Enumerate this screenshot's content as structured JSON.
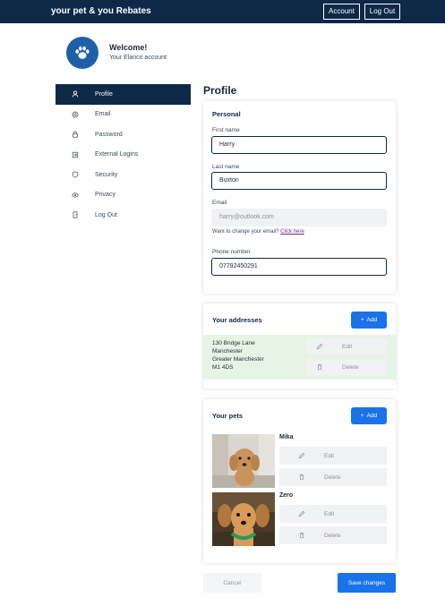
{
  "header": {
    "brand": "your pet & you Rebates",
    "account_label": "Account",
    "logout_label": "Log Out",
    "background_color": "#0e2847"
  },
  "welcome": {
    "title": "Welcome!",
    "subtitle": "Your Elanco account",
    "avatar_icon": "paw-icon"
  },
  "sidebar": {
    "items": [
      {
        "label": "Profile",
        "icon": "user-icon",
        "active": true
      },
      {
        "label": "Email",
        "icon": "at-icon",
        "active": false
      },
      {
        "label": "Password",
        "icon": "lock-icon",
        "active": false
      },
      {
        "label": "External Logins",
        "icon": "login-icon",
        "active": false
      },
      {
        "label": "Security",
        "icon": "shield-icon",
        "active": false
      },
      {
        "label": "Privacy",
        "icon": "eye-icon",
        "active": false
      },
      {
        "label": "Log Out",
        "icon": "door-icon",
        "active": false
      }
    ]
  },
  "page": {
    "title": "Profile"
  },
  "personal": {
    "title": "Personal",
    "first_name_label": "First name",
    "first_name_value": "Harry",
    "last_name_label": "Last name",
    "last_name_value": "Buxton",
    "email_label": "Email",
    "email_placeholder": "harry@outlook.com",
    "email_hint": "Want to change your email?",
    "email_hint_link": "Click here",
    "phone_label": "Phone number",
    "phone_value": "07792450291"
  },
  "addresses": {
    "title": "Your addresses",
    "add_label": "Add",
    "items": [
      {
        "line1": "130 Bridge Lane",
        "line2": "Manchester",
        "line3": "Greater Manchester",
        "line4": "M1 4DS",
        "edit_label": "Edit",
        "delete_label": "Delete"
      }
    ]
  },
  "pets": {
    "title": "Your pets",
    "add_label": "Add",
    "items": [
      {
        "name": "Mika",
        "edit_label": "Edit",
        "delete_label": "Delete"
      },
      {
        "name": "Zero",
        "edit_label": "Edit",
        "delete_label": "Delete"
      }
    ]
  },
  "footer": {
    "cancel_label": "Cancel",
    "save_label": "Save changes"
  },
  "colors": {
    "primary": "#1a73e8",
    "navy": "#0e2847",
    "address_highlight": "#e6f4e6"
  }
}
